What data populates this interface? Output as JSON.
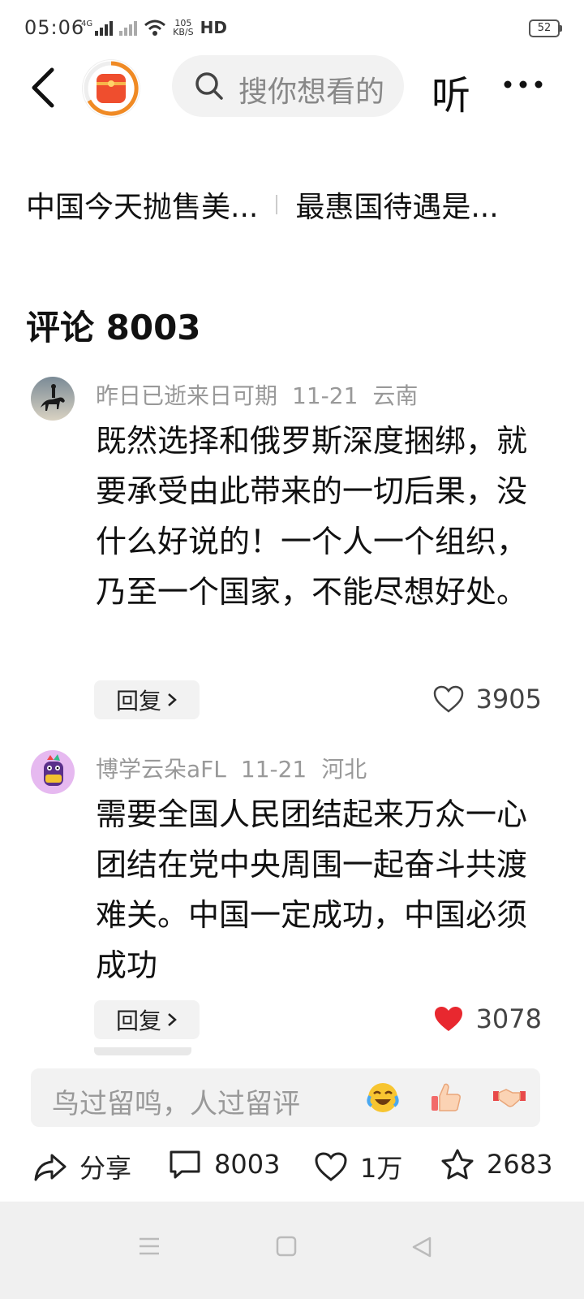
{
  "status_bar": {
    "time": "05:06",
    "network_label": "4G",
    "net_speed_value": "105",
    "net_speed_unit": "KB/S",
    "hd_label": "HD",
    "battery": "52"
  },
  "nav": {
    "search_placeholder": "搜你想看的",
    "listen_label": "听"
  },
  "related_articles": [
    {
      "title": "中国今天抛售美..."
    },
    {
      "title": "最惠国待遇是..."
    }
  ],
  "comments_section": {
    "heading": "评论 8003"
  },
  "comments": [
    {
      "username": "昨日已逝来日可期",
      "date": "11-21",
      "location": "云南",
      "text": "既然选择和俄罗斯深度捆绑，就要承受由此带来的一切后果，没什么好说的！一个人一个组织，乃至一个国家，不能尽想好处。",
      "reply_label": "回复",
      "likes": "3905",
      "liked": false
    },
    {
      "username": "博学云朵aFL",
      "date": "11-21",
      "location": "河北",
      "text": "需要全国人民团结起来万众一心团结在党中央周围一起奋斗共渡难关。中国一定成功，中国必须成功",
      "reply_label": "回复",
      "likes": "3078",
      "liked": true
    }
  ],
  "input": {
    "placeholder": "鸟过留鸣，人过留评"
  },
  "actions": {
    "share_label": "分享",
    "comment_count": "8003",
    "like_count": "1万",
    "favorite_count": "2683"
  },
  "colors": {
    "accent_orange": "#f08a24",
    "liked_red": "#e8282f",
    "muted_text": "#999999"
  }
}
